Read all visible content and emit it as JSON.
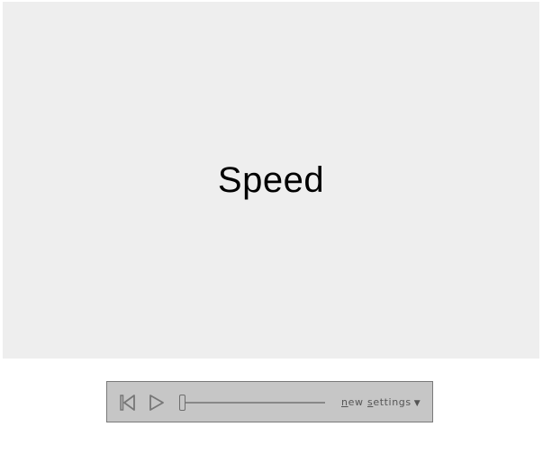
{
  "stage": {
    "title": "Speed",
    "background": "#eeeeee"
  },
  "controls": {
    "reset_icon": "skip-to-start-icon",
    "play_icon": "play-icon",
    "slider_value": 0,
    "new_label_first": "n",
    "new_label_rest": "ew",
    "settings_label_first": "s",
    "settings_label_rest": "ettings",
    "settings_caret": "▼",
    "background": "#c6c6c6",
    "icon_color": "#777777"
  }
}
